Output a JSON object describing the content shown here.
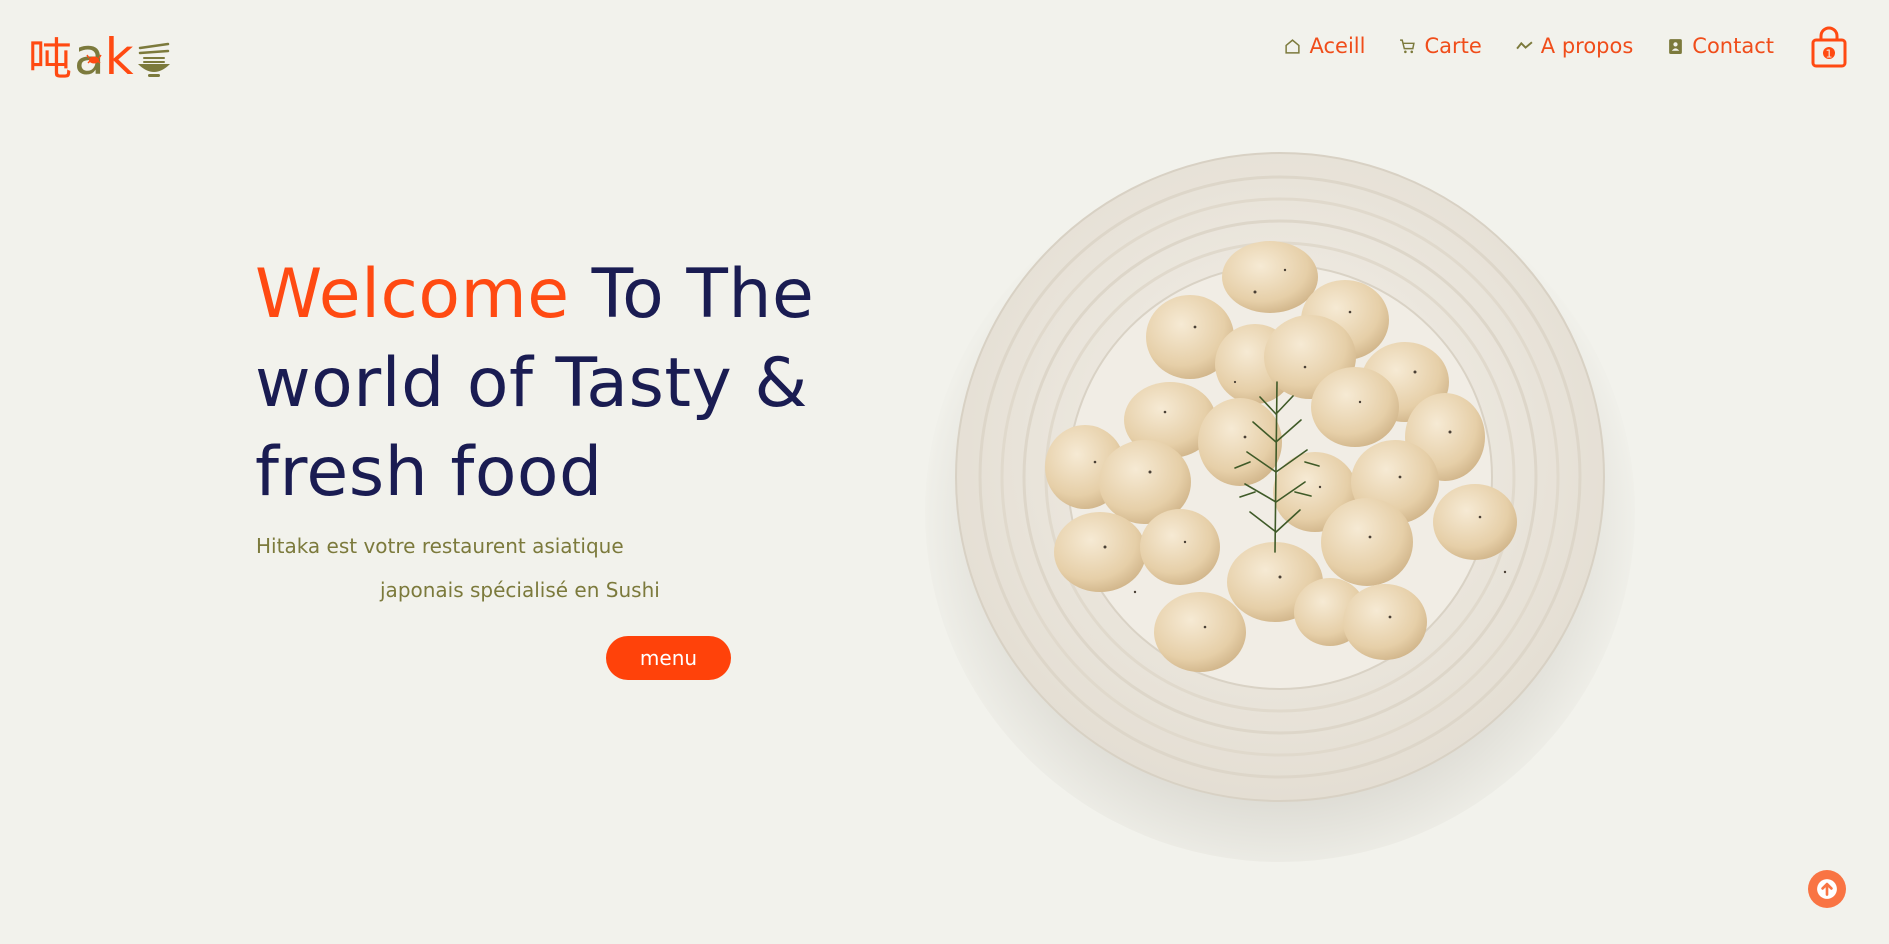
{
  "brand": {
    "logo_char": "吨",
    "logo_a": "a",
    "logo_k": "k",
    "colors": {
      "accent": "#ff4a12",
      "olive": "#7c7a3c",
      "navy": "#1a1c52"
    }
  },
  "nav": {
    "items": [
      {
        "label": "Aceill",
        "icon": "home-icon"
      },
      {
        "label": "Carte",
        "icon": "cart-icon"
      },
      {
        "label": "A propos",
        "icon": "chart-line-icon"
      },
      {
        "label": "Contact",
        "icon": "contact-card-icon"
      }
    ],
    "cart_icon": "shopping-bag-icon",
    "cart_count": "1"
  },
  "hero": {
    "title_accent": "Welcome",
    "title_rest": "To The world of Tasty & fresh food",
    "description_line1": "Hitaka est votre restaurent asiatique",
    "description_line2": "japonais spécialisé en Sushi",
    "cta_label": "menu"
  },
  "scroll_top_icon": "arrow-up-icon"
}
